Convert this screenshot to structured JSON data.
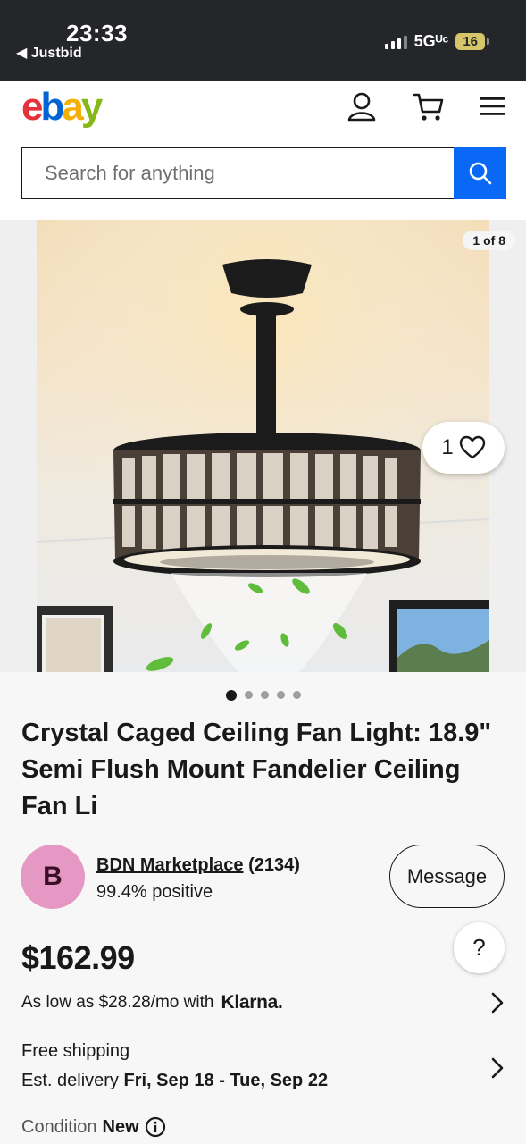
{
  "status_bar": {
    "time": "23:33",
    "back_label": "◀ Justbid",
    "network": "5Gᵁᶜ",
    "battery": "16"
  },
  "header": {
    "logo": {
      "e": "e",
      "b": "b",
      "a": "a",
      "y": "y"
    },
    "icons": [
      "account-icon",
      "cart-icon",
      "menu-icon"
    ]
  },
  "search": {
    "placeholder": "Search for anything"
  },
  "gallery": {
    "counter": "1 of 8",
    "watch_count": "1",
    "total_images": 5,
    "active_index": 0
  },
  "listing": {
    "title": "Crystal Caged Ceiling Fan Light: 18.9\" Semi Flush Mount Fandelier Ceiling Fan Li",
    "price": "$162.99"
  },
  "seller": {
    "initial": "B",
    "name": "BDN Marketplace",
    "feedback_count": "(2134)",
    "positive": "99.4% positive",
    "message_label": "Message",
    "avatar_color": "#e598c4"
  },
  "help_label": "?",
  "financing": {
    "text": "As low as $28.28/mo with",
    "provider": "Klarna."
  },
  "shipping": {
    "line1": "Free shipping",
    "delivery_prefix": "Est. delivery ",
    "delivery_dates": "Fri, Sep 18 - Tue, Sep 22"
  },
  "condition": {
    "label": "Condition",
    "value": "New"
  },
  "colors": {
    "search_button": "#0968f6",
    "status_bar": "#24262a"
  }
}
